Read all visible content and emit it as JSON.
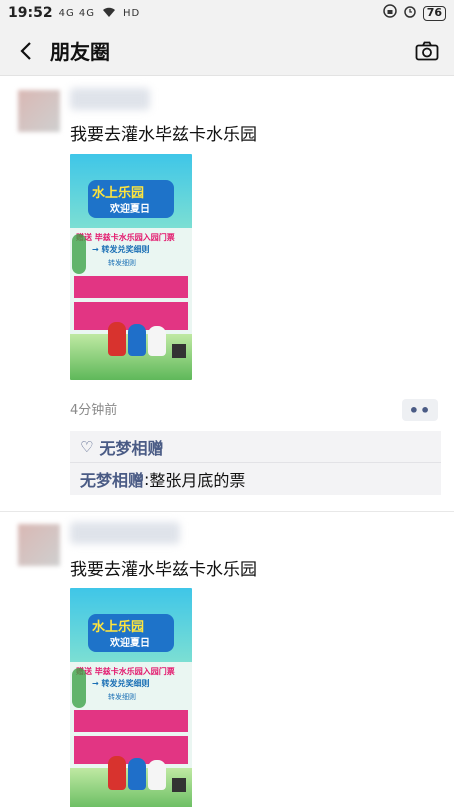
{
  "statusbar": {
    "time": "19:52",
    "signal": "4G 4G",
    "network": "HD",
    "battery": "76"
  },
  "header": {
    "title": "朋友圈"
  },
  "posts": [
    {
      "text": "我要去灌水毕兹卡水乐园",
      "poster": {
        "title": "水上乐园",
        "subtitle": "欢迎夏日",
        "line1": "赠送 毕兹卡水乐园入园门票",
        "line2": "→ 转发兑奖细则",
        "line3": "转发细则"
      },
      "time_ago": "4分钟前",
      "likes": "无梦相赠",
      "comment": {
        "author": "无梦相赠",
        "separator": ": ",
        "text": "整张月底的票"
      }
    },
    {
      "text": "我要去灌水毕兹卡水乐园",
      "poster": {
        "title": "水上乐园",
        "subtitle": "欢迎夏日",
        "line1": "赠送 毕兹卡水乐园入园门票",
        "line2": "→ 转发兑奖细则",
        "line3": "转发细则"
      }
    }
  ],
  "colors": {
    "link": "#4a5b85",
    "header_bg": "#f2f2f2"
  },
  "icons": {
    "back": "chevron-left-icon",
    "camera": "camera-icon",
    "like": "heart-icon",
    "more": "more-dots-icon"
  }
}
